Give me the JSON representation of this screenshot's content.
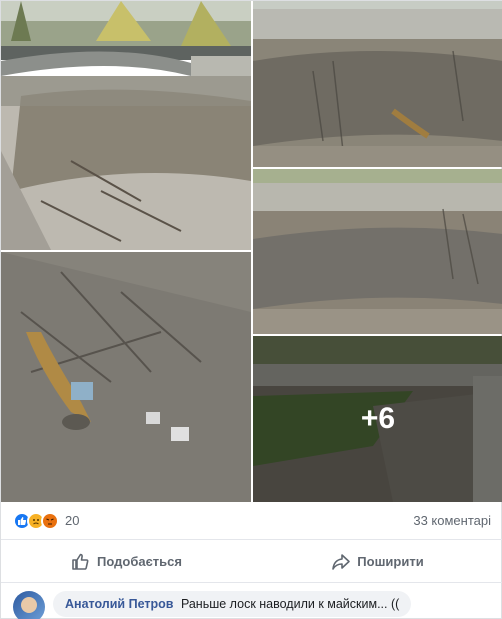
{
  "photos": {
    "more_label": "+6"
  },
  "reactions": {
    "icons": [
      "like-icon",
      "sad-icon",
      "angry-icon"
    ],
    "count": "20",
    "comments": "33 коментарі"
  },
  "actions": {
    "like_label": "Подобається",
    "share_label": "Поширити"
  },
  "comment": {
    "author": "Анатолий Петров",
    "text": "Раньше лоск наводили к майским... (("
  },
  "colors": {
    "like_blue": "#1877f2",
    "author_link": "#385898"
  }
}
